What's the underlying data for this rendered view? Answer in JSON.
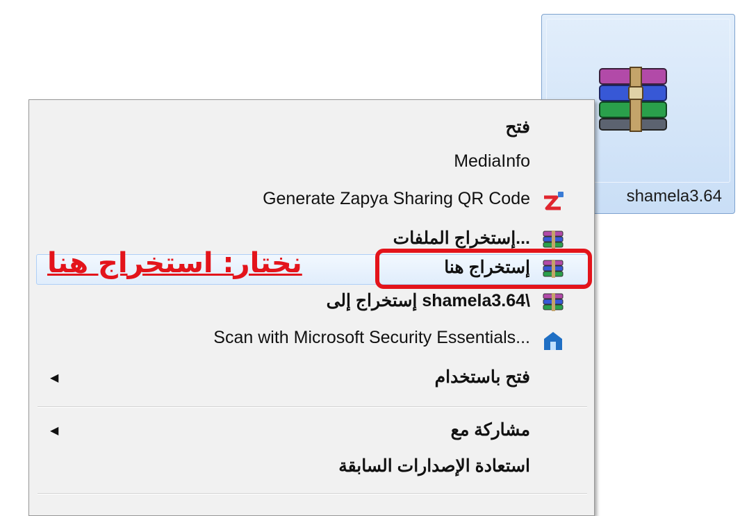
{
  "file": {
    "name": "shamela3.64",
    "icon": "winrar-archive-icon"
  },
  "menu": {
    "items": [
      {
        "label": "فتح",
        "icon": null
      },
      {
        "label": "MediaInfo",
        "icon": null
      },
      {
        "label": "Generate Zapya Sharing QR Code",
        "icon": "zapya-icon"
      },
      {
        "label": "إستخراج الملفات...",
        "icon": "winrar-icon"
      },
      {
        "label": "إستخراج هنا",
        "icon": "winrar-icon",
        "highlighted": true
      },
      {
        "label": "إستخراج إلى shamela3.64\\",
        "icon": "winrar-icon"
      },
      {
        "label": "Scan with Microsoft Security Essentials...",
        "icon": "security-essentials-icon"
      },
      {
        "label": "فتح باستخدام",
        "submenu": true
      },
      {
        "label": "مشاركة مع",
        "submenu": true
      },
      {
        "label": "استعادة الإصدارات السابقة"
      }
    ]
  },
  "annotation": {
    "text": "نختار: استخراج هنا",
    "color": "#e3141b"
  },
  "colors": {
    "menu_bg": "#f1f1f1",
    "highlight": "#e0edfc",
    "selection_tile": "#c9def6"
  }
}
